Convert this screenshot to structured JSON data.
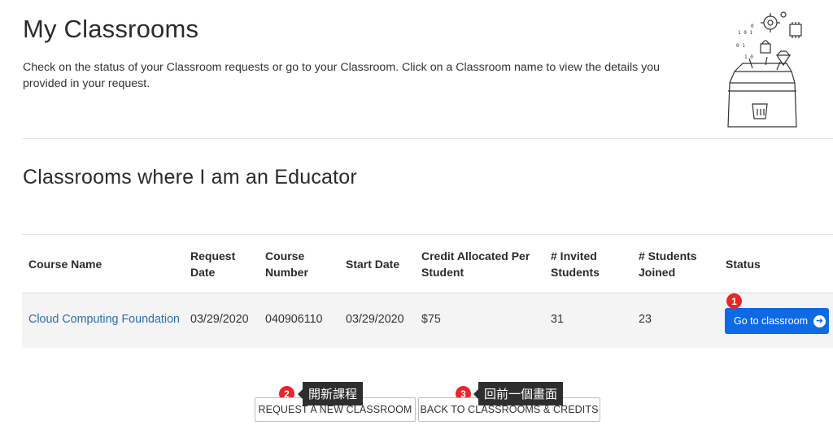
{
  "header": {
    "title": "My Classrooms",
    "intro": "Check on the status of your Classroom requests or go to your Classroom. Click on a Classroom name to view the details you provided in your request."
  },
  "section": {
    "title": "Classrooms where I am an Educator"
  },
  "table": {
    "headers": {
      "course_name": "Course Name",
      "request_date": [
        "Request",
        "Date"
      ],
      "course_number": [
        "Course",
        "Number"
      ],
      "start_date": "Start Date",
      "credit": [
        "Credit Allocated Per",
        "Student"
      ],
      "invited": [
        "# Invited",
        "Students"
      ],
      "joined": [
        "# Students",
        "Joined"
      ],
      "status": "Status"
    },
    "rows": [
      {
        "course_name": "Cloud Computing Foundation",
        "request_date": "03/29/2020",
        "course_number": "040906110",
        "start_date": "03/29/2020",
        "credit": "$75",
        "invited": "31",
        "joined": "23",
        "status_button": "Go to classroom"
      }
    ]
  },
  "annotations": {
    "marker_1": "1",
    "marker_2": "2",
    "marker_3": "3",
    "tooltip_2": "開新課程",
    "tooltip_3": "回前一個畫面"
  },
  "footer": {
    "request_button": "REQUEST A NEW CLASSROOM",
    "back_button": "BACK TO CLASSROOMS & CREDITS"
  },
  "colors": {
    "primary_button": "#0d6ae4",
    "link": "#2c6db2",
    "marker": "#e8262b",
    "tooltip": "#2e2e2e"
  },
  "icons": {
    "go_arrow": "arrow-right-circle-icon",
    "illustration": "treasure-chest-illustration"
  }
}
